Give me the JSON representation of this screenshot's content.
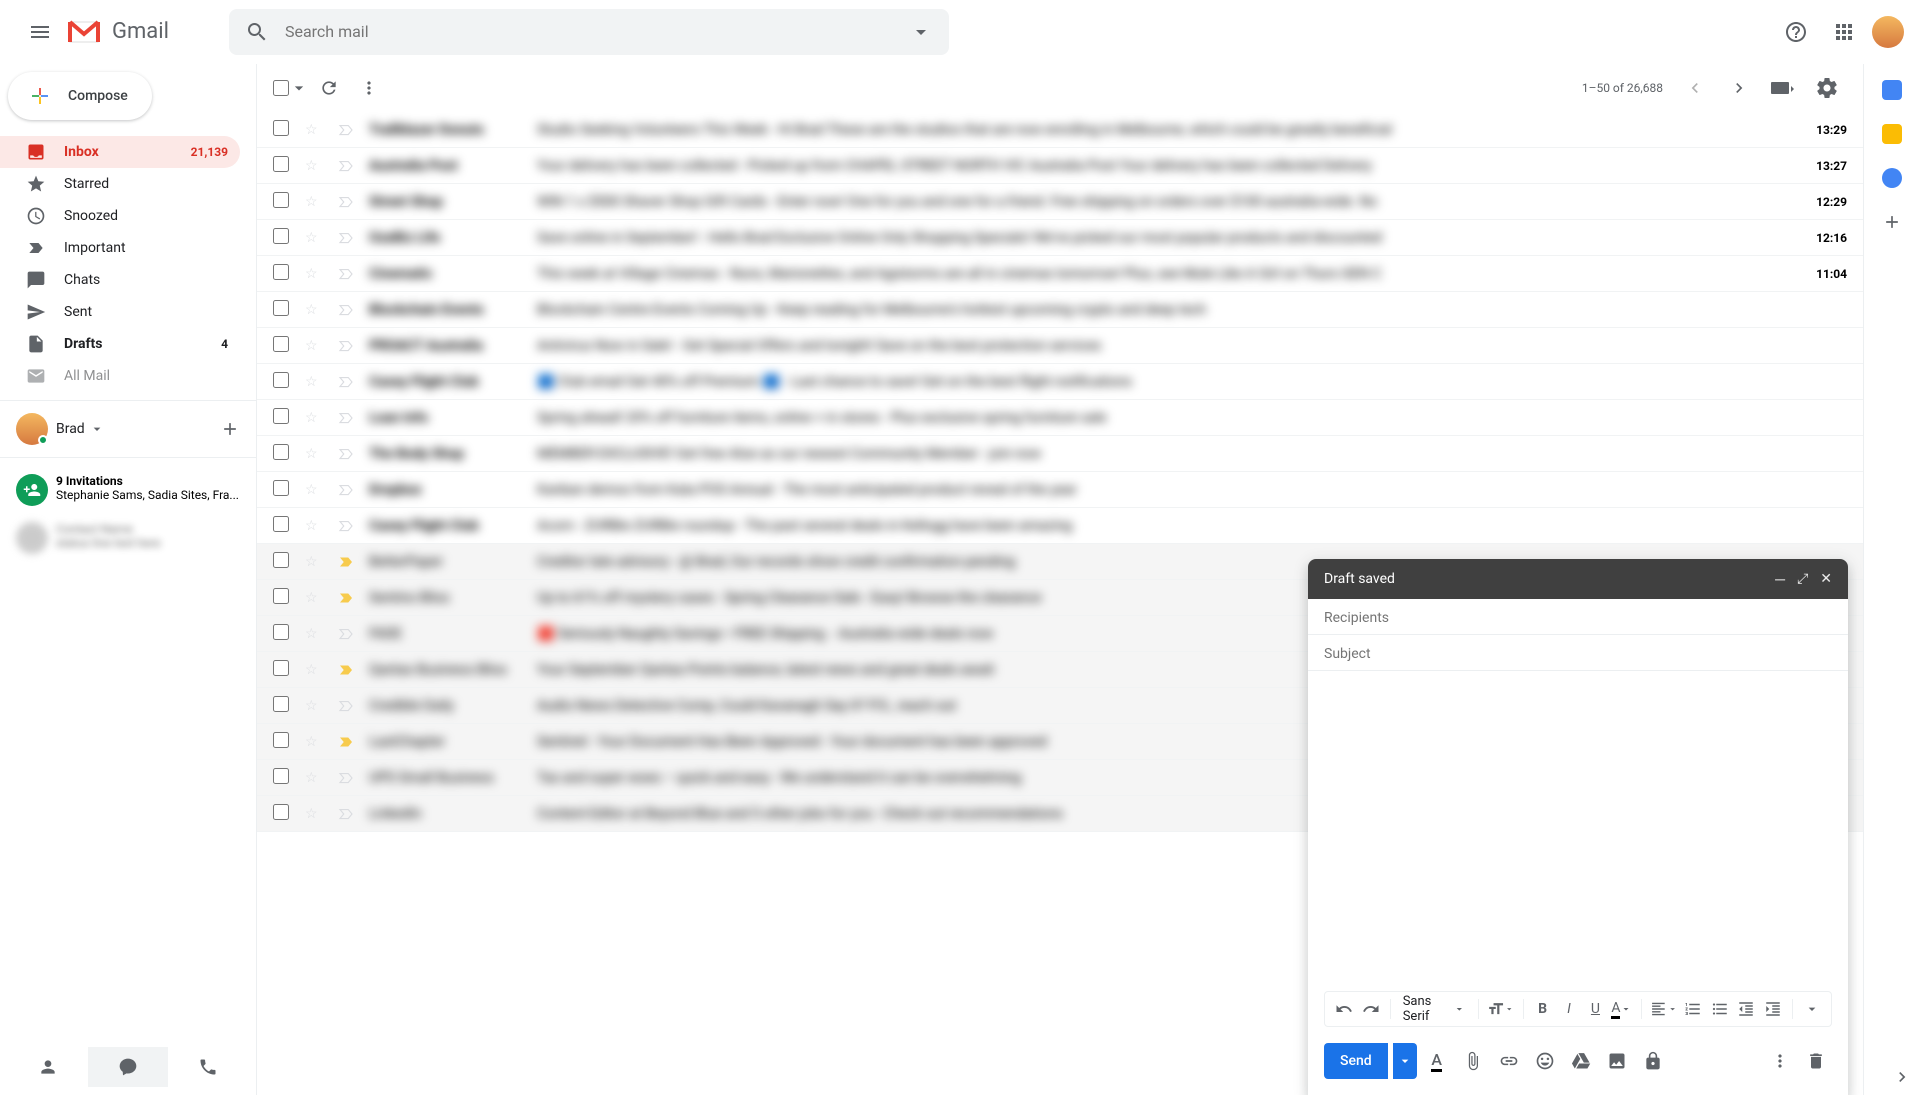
{
  "header": {
    "app_name": "Gmail",
    "search_placeholder": "Search mail"
  },
  "sidebar": {
    "compose_label": "Compose",
    "items": [
      {
        "label": "Inbox",
        "count": "21,139",
        "active": true,
        "bold": true
      },
      {
        "label": "Starred"
      },
      {
        "label": "Snoozed"
      },
      {
        "label": "Important"
      },
      {
        "label": "Chats"
      },
      {
        "label": "Sent"
      },
      {
        "label": "Drafts",
        "count": "4",
        "bold": true
      },
      {
        "label": "All Mail"
      }
    ],
    "user_name": "Brad",
    "invitations": {
      "title": "9 Invitations",
      "subtitle": "Stephanie Sams, Sadia Sites, Fra..."
    }
  },
  "toolbar": {
    "pagination": "1–50 of 26,688"
  },
  "emails": [
    {
      "sender": "Trailblazer Donuts",
      "subject": "Studio Seeking Volunteers This Week - Hi Brad These are the studios that are now enrolling in Melbourne, which could be greatly beneficial",
      "time": "13:29"
    },
    {
      "sender": "Australia Post",
      "subject": "Your delivery has been collected - Picked up from CHAPEL STREET NORTH VIC Australia Post Your delivery has been collected Delivery",
      "time": "13:27"
    },
    {
      "sender": "Street Shop",
      "subject": "WIN 1 x $500 Shaver Shop Gift Cards - Enter now! One for you and one for a friend. Free shipping on orders over $100 australia-wide. No",
      "time": "12:29"
    },
    {
      "sender": "OzeBiz Life",
      "subject": "Save online in September! - Hello Brad Exclusive Online Only Shopping Specials! We've picked our most popular products and discounted",
      "time": "12:16"
    },
    {
      "sender": "Cinematic",
      "subject": "This week at Village Cinemas - Nuns, Marionettes, and Agistorms are all in cinemas tomorrow! Plus, see Mule Like A Girl on Thurs GEN C",
      "time": "11:04"
    },
    {
      "sender": "Blockchain Events",
      "subject": "Blockchain Centre Events Coming Up - Keep reading for Melbourne's hottest upcoming crypto and deep tech",
      "time": ""
    },
    {
      "sender": "PROACT Australia",
      "subject": "Antivirus Now in Sale! - Get Special Offers and tonight! Save on the best protection services",
      "time": ""
    },
    {
      "sender": "Casey Flight Club",
      "subject": "🟦 Club email Get 40% off Premium 🟦 - Last chance to save! Get on the best flight notifications",
      "time": ""
    },
    {
      "sender": "Loan Info",
      "subject": "Spring ahead! 20% off furniture items, online + in stores - Plus exclusive spring furniture sale",
      "time": ""
    },
    {
      "sender": "The Body Shop",
      "subject": "MEMBER EXCLUSIVE! Get free Aloe as our newest Community Member - join now",
      "time": ""
    },
    {
      "sender": "Dropbox",
      "subject": "Kanban demos from Kata POS Annual - The most anticipated product reveal of the year",
      "time": ""
    },
    {
      "sender": "Casey Flight Club",
      "subject": "Acorn - ZURBie ZURBie roundup - The past several deals in Kellogg have been amazing",
      "time": ""
    },
    {
      "sender": "BetterPaper",
      "subject": "Creditor late advisory - @ Brad, Our records show credit confirmation pending",
      "time": "",
      "read": true,
      "imp": true
    },
    {
      "sender": "Sentino Bliss",
      "subject": "Up to 61% off mystery cases - Spring Clearance Sale - Easy! Browse the clearance",
      "time": "",
      "read": true,
      "imp": true
    },
    {
      "sender": "FADE",
      "subject": "🟥 Seriously Naughty Savings • FREE Shipping. - Australia wide deals now",
      "time": "",
      "read": true
    },
    {
      "sender": "Qantas Business Bliss",
      "subject": "Your September Qantas Points balance, latest news and great deals await",
      "time": "",
      "read": true,
      "imp": true
    },
    {
      "sender": "Credible Daily",
      "subject": "Audio News Detective Comp, Could Kavanagh Say It? P.S., reach out",
      "time": "",
      "read": true
    },
    {
      "sender": "LastChapter",
      "subject": "Sentinel - Your Document Has Been Approved - Your document has been approved",
      "time": "",
      "read": true,
      "imp": true
    },
    {
      "sender": "UPS Small Business",
      "subject": "Tax and super woes – quick and easy - We understand it can be overwhelming",
      "time": "",
      "read": true
    },
    {
      "sender": "LinkedIn",
      "subject": "Content Editor at Beyond Blue and 5 other jobs for you - Check out recommendations",
      "time": "",
      "read": true
    }
  ],
  "compose": {
    "header": "Draft saved",
    "recipients_placeholder": "Recipients",
    "subject_placeholder": "Subject",
    "font": "Sans Serif",
    "send_label": "Send"
  }
}
